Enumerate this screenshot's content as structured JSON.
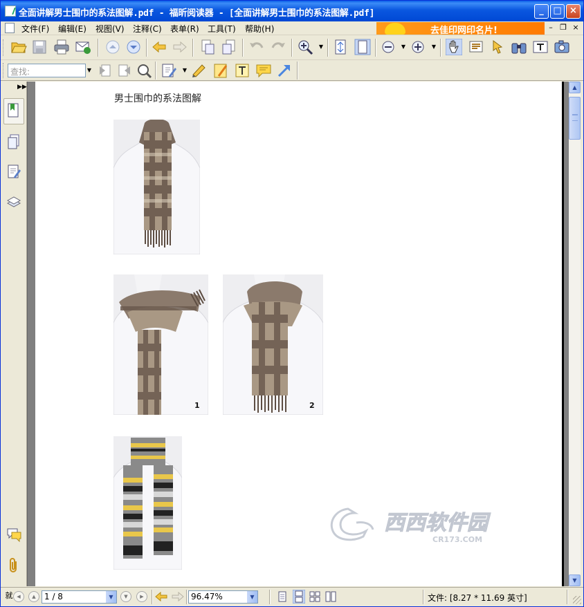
{
  "window": {
    "title": "全面讲解男士围巾的系法图解.pdf - 福昕阅读器 - [全面讲解男士围巾的系法图解.pdf]"
  },
  "title_buttons": {
    "minimize": "_",
    "maximize": "□",
    "close": "×"
  },
  "menu": {
    "items": [
      {
        "label": "文件(F)"
      },
      {
        "label": "编辑(E)"
      },
      {
        "label": "视图(V)"
      },
      {
        "label": "注释(C)"
      },
      {
        "label": "表单(R)"
      },
      {
        "label": "工具(T)"
      },
      {
        "label": "帮助(H)"
      }
    ],
    "ad_text": "去佳印网印名片!",
    "mdi_buttons": {
      "minimize": "–",
      "restore": "❐",
      "close": "×"
    }
  },
  "toolbar": {
    "find_placeholder": "查找:"
  },
  "document": {
    "heading": "男士围巾的系法图解",
    "step_labels": [
      "1",
      "2"
    ],
    "watermark": "西西软件园 CR173.COM"
  },
  "colors": {
    "titlebar": "#0a57e0",
    "ad": "#ff8a00",
    "scarf_brown": "#6b5a4e",
    "scarf_tan": "#b8a58c",
    "scarf_yellow": "#e9c74a"
  },
  "statusbar": {
    "page_value": "1 / 8",
    "zoom_value": "96.47%",
    "file_size": "文件: [8.27 * 11.69 英寸]"
  }
}
